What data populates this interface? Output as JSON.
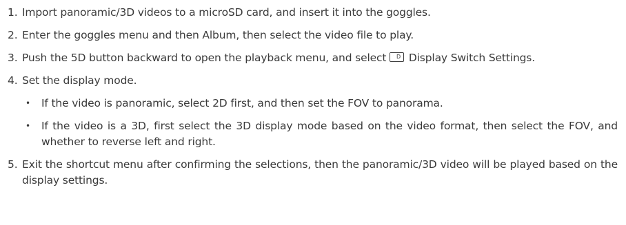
{
  "steps": [
    {
      "number": "1.",
      "text": "Import panoramic/3D videos to a microSD card, and insert it into the goggles."
    },
    {
      "number": "2.",
      "text": "Enter the goggles menu and then Album, then select the video file to play."
    },
    {
      "number": "3.",
      "text_before": "Push the 5D button backward to open the playback menu, and select",
      "icon_label": "2D",
      "icon_name": "display-switch-2d-icon",
      "text_after": " Display Switch Settings."
    },
    {
      "number": "4.",
      "text": "Set the display mode.",
      "bullets": [
        "If the video is panoramic, select 2D first, and then set the FOV to panorama.",
        "If the video is a 3D, first select the 3D display mode based on the video format, then select the FOV, and whether to reverse left and right."
      ],
      "bullet_symbol": "•"
    },
    {
      "number": "5.",
      "text": "Exit the shortcut menu after confirming the selections, then the panoramic/3D video will be played based on the display settings."
    }
  ]
}
